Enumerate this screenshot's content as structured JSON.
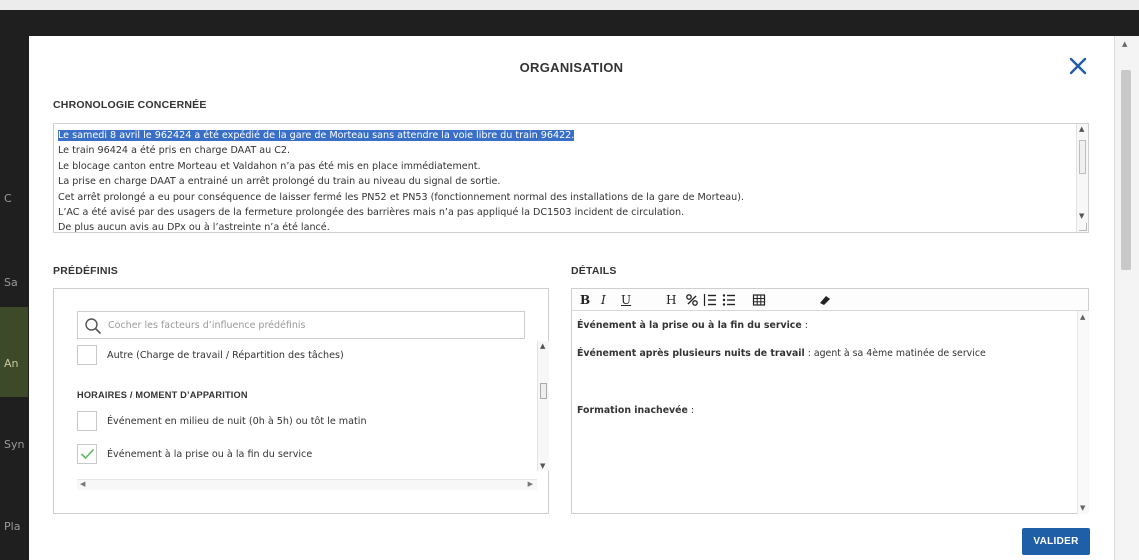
{
  "modal": {
    "title": "ORGANISATION",
    "validate_label": "VALIDER"
  },
  "chronologie": {
    "label": "CHRONOLOGIE CONCERNÉE",
    "lines": [
      "Le samedi 8 avril le 962424 a été expédié de la gare de Morteau sans attendre la voie libre du train 96422.",
      "Le train 96424 a été pris en charge DAAT au C2.",
      "Le blocage canton entre Morteau et Valdahon n’a pas été mis en place immédiatement.",
      "La prise en charge DAAT a entrainé un arrêt prolongé du train au niveau du signal de sortie.",
      "Cet arrêt prolongé a eu pour conséquence de laisser fermé les PN52 et PN53 (fonctionnement normal des installations de la gare de Morteau).",
      "L’AC a été avisé par des usagers de la fermeture prolongée des barrières mais n’a pas appliqué la DC1503 incident de circulation.",
      "De plus aucun avis au DPx ou à l’astreinte n’a été lancé."
    ],
    "selected_line_index": 0
  },
  "predefinis": {
    "label": "PRÉDÉFINIS",
    "search_placeholder": "Cocher les facteurs d’influence prédéfinis",
    "items": [
      {
        "text": "Autre (Charge de travail / Répartition des tâches)",
        "checked": false
      },
      {
        "heading": "HORAIRES / MOMENT D’APPARITION"
      },
      {
        "text": "Événement en milieu de nuit (0h à 5h) ou tôt le matin",
        "checked": false
      },
      {
        "text": "Événement à la prise ou à la fin du service",
        "checked": true
      }
    ]
  },
  "details": {
    "label": "DÉTAILS",
    "toolbar": {
      "bold": "B",
      "italic": "I",
      "underline": "U",
      "heading": "H"
    },
    "content": [
      {
        "bold": "Événement à la prise ou à la fin du service",
        "rest": " :"
      },
      {
        "bold": "Événement après plusieurs nuits de travail",
        "rest": " : agent à sa 4ème matinée de service"
      },
      {
        "bold": "Formation inachevée",
        "rest": " :"
      }
    ]
  },
  "background": {
    "side_labels": [
      "C",
      "Sa",
      "An",
      "Syn",
      "Pla"
    ]
  },
  "colors": {
    "accent_blue": "#1f5fa8",
    "check_green": "#5cb85c",
    "selection": "#3a6fc8"
  }
}
